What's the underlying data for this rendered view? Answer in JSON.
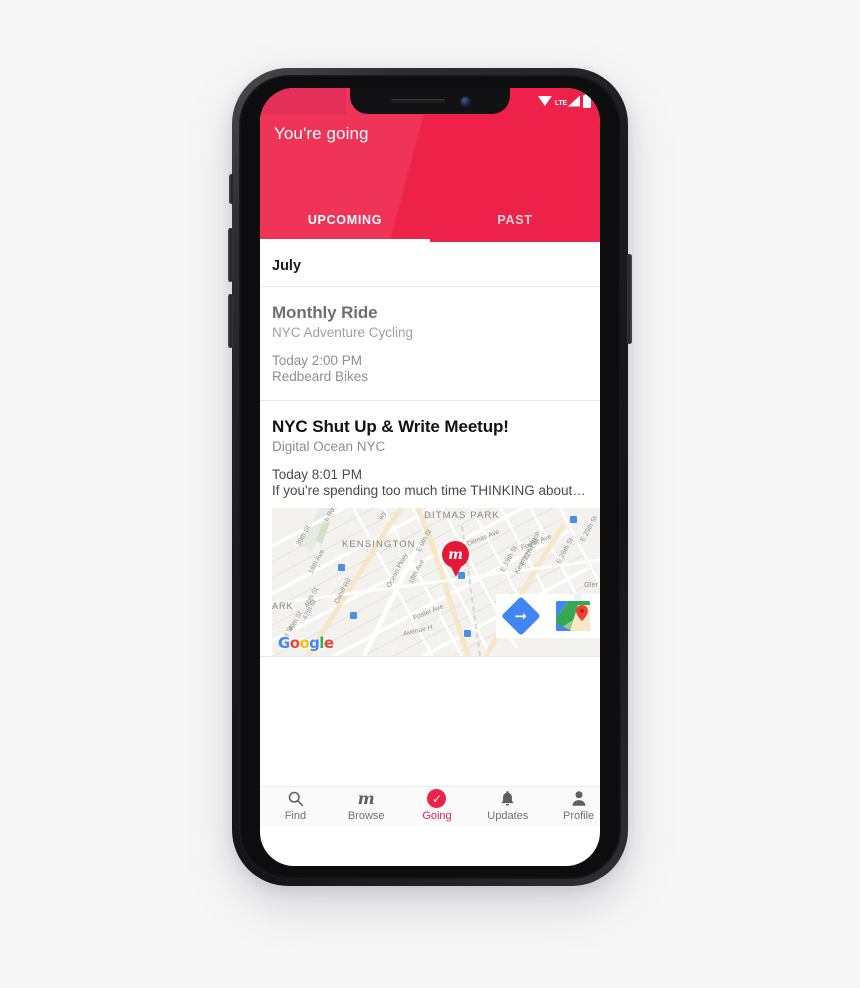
{
  "app": {
    "header_title": "You're going",
    "brand_red": "#ee2148",
    "status_bar": {
      "wifi_icon": "wifi-icon",
      "network_label": "LTE",
      "signal_icon": "signal-bars-icon",
      "battery_icon": "battery-icon"
    }
  },
  "tabs": [
    {
      "label": "UPCOMING",
      "active": true
    },
    {
      "label": "PAST",
      "active": false
    }
  ],
  "list": {
    "section_header": "July",
    "events": [
      {
        "title": "Monthly Ride",
        "group": "NYC Adventure Cycling",
        "when": "Today 2:00 PM",
        "where": "Redbeard Bikes",
        "style": "muted",
        "has_map": false
      },
      {
        "title": "NYC Shut Up & Write Meetup!",
        "group": "Digital Ocean NYC",
        "when": "Today 8:01 PM",
        "where": "If you're spending too much time THINKING about…",
        "style": "normal",
        "has_map": true
      }
    ]
  },
  "map": {
    "watermark": "Google",
    "watermark_letters": [
      "G",
      "o",
      "o",
      "g",
      "l",
      "e"
    ],
    "pin_icon": "meetup-location-pin-icon",
    "directions_icon": "directions-arrow-icon",
    "gmaps_icon": "google-maps-icon",
    "place_labels": [
      "DITMAS PARK",
      "KENSINGTON",
      "ARK",
      "Gler"
    ],
    "street_labels": [
      "39th St",
      "h Rd",
      "16th Ave",
      "Dahill Rd",
      "Ocean Pkwy",
      "18th Ave",
      "E 9th St",
      "wy",
      "Ditmas Ave",
      "Foster Ave",
      "E 19th St",
      "Foster Ave",
      "E 22nd St",
      "Kenmore Place",
      "E 26th St",
      "E 29th St",
      "Avenue H",
      "46th St",
      "47th St",
      "49th St",
      "52nd St"
    ]
  },
  "bottom_nav": [
    {
      "label": "Find",
      "icon": "search-icon",
      "active": false
    },
    {
      "label": "Browse",
      "icon": "meetup-m-icon",
      "active": false
    },
    {
      "label": "Going",
      "icon": "check-circle-icon",
      "active": true
    },
    {
      "label": "Updates",
      "icon": "bell-icon",
      "active": false
    },
    {
      "label": "Profile",
      "icon": "person-icon",
      "active": false
    }
  ]
}
